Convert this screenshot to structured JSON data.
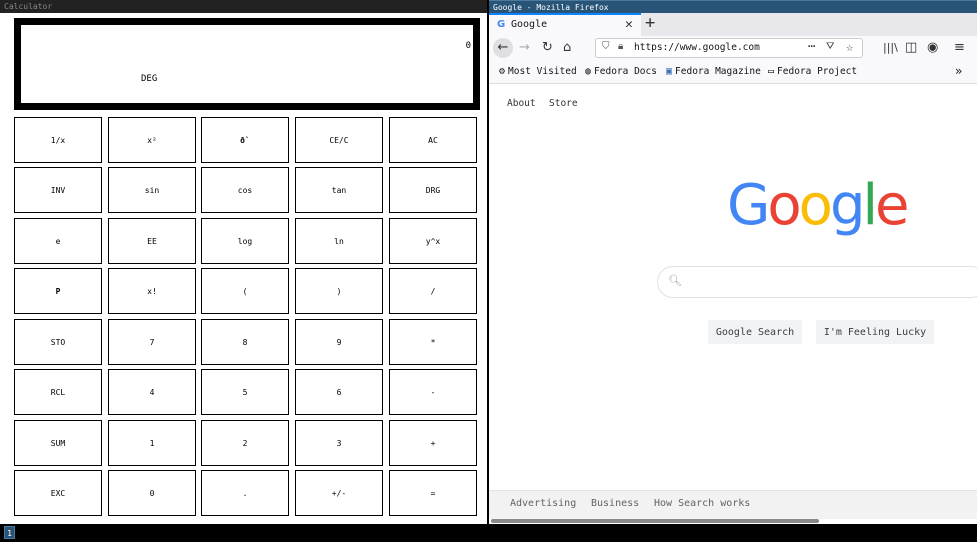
{
  "calculator": {
    "window_title": "Calculator",
    "display_value": "0",
    "mode": "DEG",
    "keys": [
      [
        "1/x",
        "x²",
        "ð`",
        "CE/C",
        "AC"
      ],
      [
        "INV",
        "sin",
        "cos",
        "tan",
        "DRG"
      ],
      [
        "e",
        "EE",
        "log",
        "ln",
        "y^x"
      ],
      [
        "P",
        "x!",
        "(",
        ")",
        "/"
      ],
      [
        "STO",
        "7",
        "8",
        "9",
        "*"
      ],
      [
        "RCL",
        "4",
        "5",
        "6",
        "-"
      ],
      [
        "SUM",
        "1",
        "2",
        "3",
        "+"
      ],
      [
        "EXC",
        "0",
        ".",
        "+/-",
        "="
      ]
    ]
  },
  "firefox": {
    "window_title": "Google - Mozilla Firefox",
    "tab": {
      "favicon": "G",
      "label": "Google",
      "close": "✕"
    },
    "new_tab": "+",
    "url": "https://www.google.com",
    "bookmarks": [
      {
        "icon": "gear-icon",
        "glyph": "⚙",
        "label": "Most Visited"
      },
      {
        "icon": "globe-icon",
        "glyph": "◍",
        "label": "Fedora Docs"
      },
      {
        "icon": "fedora-icon",
        "glyph": "▣",
        "label": "Fedora Magazine"
      },
      {
        "icon": "folder-icon",
        "glyph": "▭",
        "label": "Fedora Project"
      }
    ],
    "overflow": "»",
    "google": {
      "top_links": [
        "About",
        "Store"
      ],
      "logo_letters": [
        {
          "ch": "G",
          "color": "#4285F4"
        },
        {
          "ch": "o",
          "color": "#EA4335"
        },
        {
          "ch": "o",
          "color": "#FBBC05"
        },
        {
          "ch": "g",
          "color": "#4285F4"
        },
        {
          "ch": "l",
          "color": "#34A853"
        },
        {
          "ch": "e",
          "color": "#EA4335"
        }
      ],
      "search_button": "Google Search",
      "lucky_button": "I'm Feeling Lucky",
      "footer_links": [
        "Advertising",
        "Business",
        "How Search works"
      ]
    }
  },
  "taskbar": {
    "workspace": "1"
  }
}
